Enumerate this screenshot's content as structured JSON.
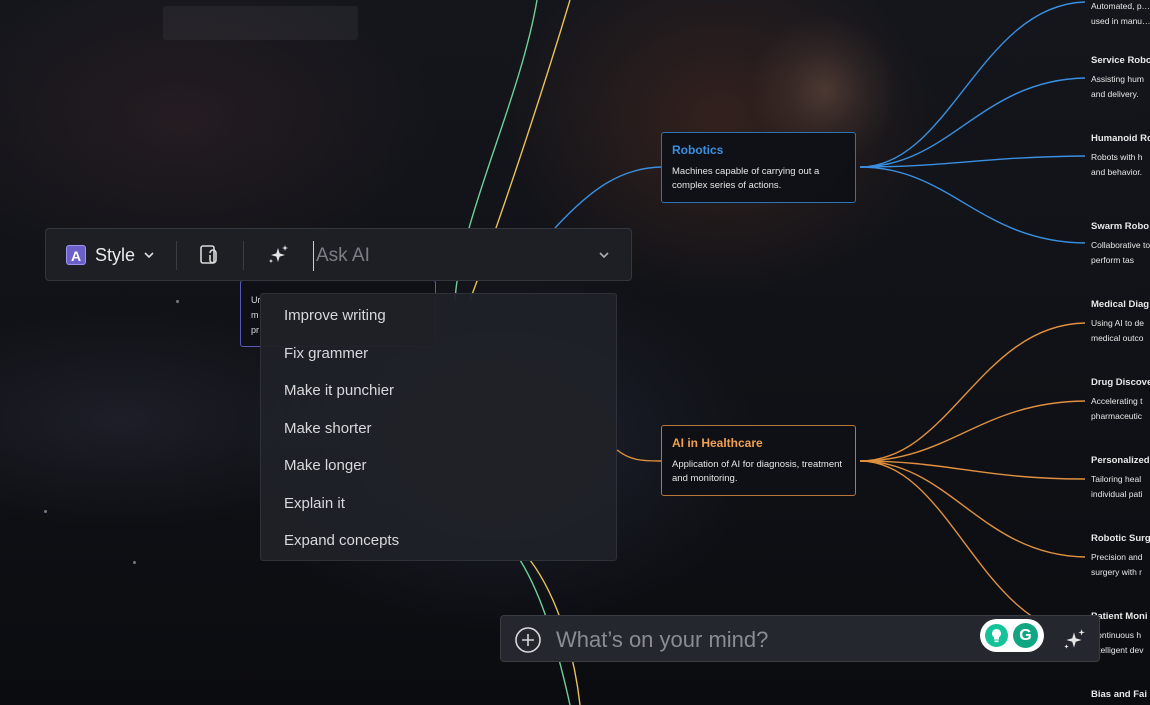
{
  "toolbar": {
    "style_badge": "A",
    "style_label": "Style",
    "ask_placeholder": "Ask AI"
  },
  "ai_menu": {
    "items": [
      {
        "label": "Improve writing"
      },
      {
        "label": "Fix grammer"
      },
      {
        "label": "Make it punchier"
      },
      {
        "label": "Make shorter"
      },
      {
        "label": "Make longer"
      },
      {
        "label": "Explain it"
      },
      {
        "label": "Expand concepts"
      }
    ]
  },
  "hidden_node": {
    "lines": [
      "Ur",
      "m",
      "pr"
    ]
  },
  "mindmap": {
    "robotics": {
      "title": "Robotics",
      "desc": "Machines capable of carrying out a complex series of actions.",
      "color": "#3a8fe0"
    },
    "healthcare": {
      "title": "AI in Healthcare",
      "desc": "Application of AI for diagnosis, treatment and monitoring.",
      "color": "#f0a050"
    },
    "leaves": [
      {
        "title": "",
        "desc": "Automated, p… used in manu…"
      },
      {
        "title": "Service Robo",
        "desc": "Assisting hum and delivery."
      },
      {
        "title": "Humanoid Ro",
        "desc": "Robots with h and behavior."
      },
      {
        "title": "Swarm Robo",
        "desc": "Collaborative to perform tas"
      },
      {
        "title": "Medical Diag",
        "desc": "Using AI to de medical outco"
      },
      {
        "title": "Drug Discove",
        "desc": "Accelerating t pharmaceutic"
      },
      {
        "title": "Personalized",
        "desc": "Tailoring heal individual pati"
      },
      {
        "title": "Robotic Surg",
        "desc": "Precision and surgery with r"
      },
      {
        "title": "Patient Moni",
        "desc": "Continuous h Intelligent dev"
      },
      {
        "title": "Bias and Fai",
        "desc": ""
      }
    ]
  },
  "chat": {
    "placeholder": "What’s on your mind?",
    "grammarly_letter": "G"
  }
}
